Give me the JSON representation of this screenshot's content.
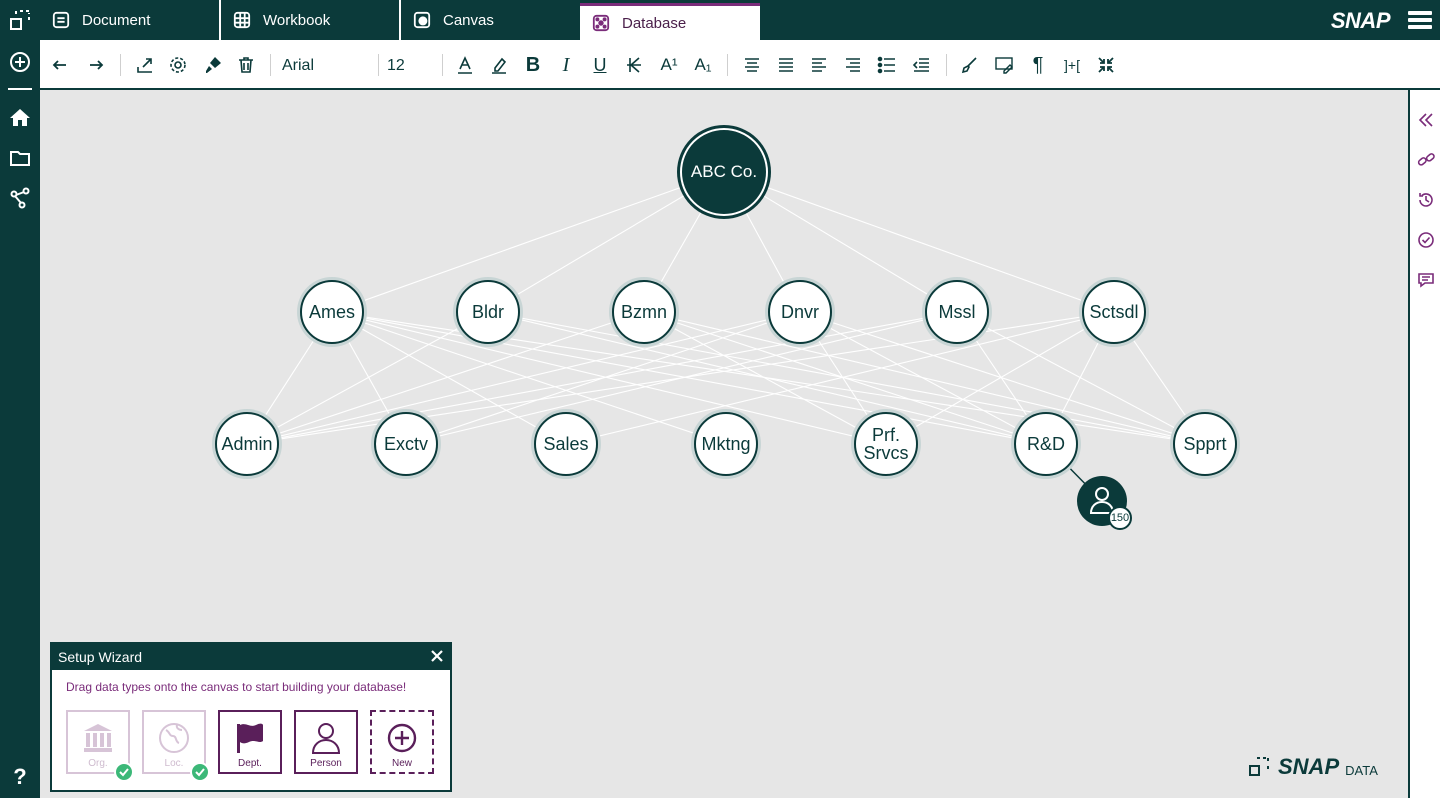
{
  "app": {
    "brand": "SNAP",
    "colors": {
      "primary": "#0b3a3a",
      "accent": "#7a2c7a",
      "success": "#3cb878",
      "canvas": "#e6e6e6"
    }
  },
  "left_rail": {
    "icons": [
      "select-area-icon",
      "add-icon",
      "home-icon",
      "folder-icon",
      "share-icon"
    ],
    "help_label": "?"
  },
  "tabs": [
    {
      "label": "Document",
      "icon": "document-icon",
      "active": false
    },
    {
      "label": "Workbook",
      "icon": "grid-icon",
      "active": false
    },
    {
      "label": "Canvas",
      "icon": "canvas-icon",
      "active": false
    },
    {
      "label": "Database",
      "icon": "database-icon",
      "active": true
    }
  ],
  "toolbar": {
    "font_family": "Arial",
    "font_size": "12",
    "icons": [
      "undo-icon",
      "redo-icon",
      "export-icon",
      "settings-icon",
      "brush-icon",
      "trash-icon",
      "font-color-icon",
      "highlight-icon",
      "bold-icon",
      "italic-icon",
      "underline-icon",
      "strikethrough-icon",
      "superscript-icon",
      "subscript-icon",
      "align-center-icon",
      "justify-icon",
      "align-left-icon",
      "align-right-icon",
      "bullet-list-icon",
      "outdent-icon",
      "paint-icon",
      "spellcheck-icon",
      "pilcrow-icon",
      "expand-icon",
      "collapse-icon"
    ],
    "bold": "B",
    "italic": "I",
    "underline": "U",
    "superscript": "A¹",
    "subscript": "A₁",
    "pilcrow": "¶",
    "expand": "]+["
  },
  "right_rail": {
    "icons": [
      "collapse-left-icon",
      "link-icon",
      "history-icon",
      "check-circle-icon",
      "comment-icon"
    ]
  },
  "graph": {
    "root": {
      "id": "root",
      "label": "ABC Co."
    },
    "locations": [
      {
        "id": "ames",
        "label": "Ames"
      },
      {
        "id": "bldr",
        "label": "Bldr"
      },
      {
        "id": "bzmn",
        "label": "Bzmn"
      },
      {
        "id": "dnvr",
        "label": "Dnvr"
      },
      {
        "id": "mssl",
        "label": "Mssl"
      },
      {
        "id": "sctsdl",
        "label": "Sctsdl"
      }
    ],
    "departments": [
      {
        "id": "admin",
        "label": "Admin"
      },
      {
        "id": "exctv",
        "label": "Exctv"
      },
      {
        "id": "sales",
        "label": "Sales"
      },
      {
        "id": "mktng",
        "label": "Mktng"
      },
      {
        "id": "prfsrvcs",
        "label": "Prf. Srvcs"
      },
      {
        "id": "rnd",
        "label": "R&D"
      },
      {
        "id": "spprt",
        "label": "Spprt"
      }
    ],
    "people_node": {
      "icon": "person-icon",
      "count": "150",
      "parent": "rnd"
    }
  },
  "wizard": {
    "title": "Setup Wizard",
    "instructions": "Drag data types onto the canvas to start building your database!",
    "tiles": [
      {
        "label": "Org.",
        "icon": "building-icon",
        "done": true
      },
      {
        "label": "Loc.",
        "icon": "globe-icon",
        "done": true
      },
      {
        "label": "Dept.",
        "icon": "flag-icon",
        "done": false
      },
      {
        "label": "Person",
        "icon": "person-icon",
        "done": false
      },
      {
        "label": "New",
        "icon": "plus-circle-icon",
        "done": false
      }
    ]
  },
  "footer_brand": {
    "name": "SNAP",
    "product": "DATA"
  }
}
